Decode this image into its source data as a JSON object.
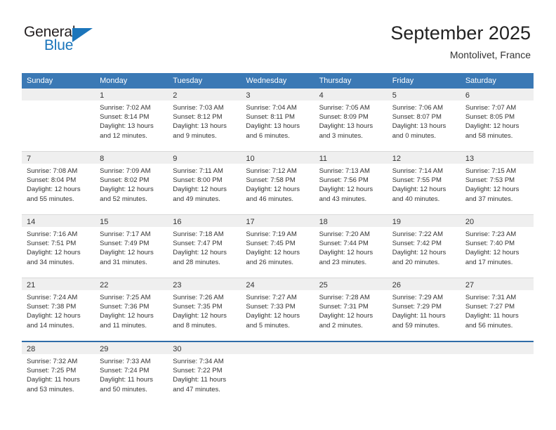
{
  "logo": {
    "text_primary": "General",
    "text_secondary": "Blue",
    "icon": "triangle-icon",
    "color_primary": "#231f20",
    "color_secondary": "#1b75bb"
  },
  "header": {
    "month_title": "September 2025",
    "location": "Montolivet, France"
  },
  "colors": {
    "header_blue": "#3b79b5",
    "day_band_gray": "#efefef",
    "separator_gray": "#d9d9d9",
    "last_row_border": "#2f6ca8",
    "text": "#333333"
  },
  "weekday_headers": [
    "Sunday",
    "Monday",
    "Tuesday",
    "Wednesday",
    "Thursday",
    "Friday",
    "Saturday"
  ],
  "weeks": [
    [
      {
        "day": "",
        "empty": true,
        "sunrise": "",
        "sunset": "",
        "daylight_1": "",
        "daylight_2": ""
      },
      {
        "day": "1",
        "sunrise": "Sunrise: 7:02 AM",
        "sunset": "Sunset: 8:14 PM",
        "daylight_1": "Daylight: 13 hours",
        "daylight_2": "and 12 minutes."
      },
      {
        "day": "2",
        "sunrise": "Sunrise: 7:03 AM",
        "sunset": "Sunset: 8:12 PM",
        "daylight_1": "Daylight: 13 hours",
        "daylight_2": "and 9 minutes."
      },
      {
        "day": "3",
        "sunrise": "Sunrise: 7:04 AM",
        "sunset": "Sunset: 8:11 PM",
        "daylight_1": "Daylight: 13 hours",
        "daylight_2": "and 6 minutes."
      },
      {
        "day": "4",
        "sunrise": "Sunrise: 7:05 AM",
        "sunset": "Sunset: 8:09 PM",
        "daylight_1": "Daylight: 13 hours",
        "daylight_2": "and 3 minutes."
      },
      {
        "day": "5",
        "sunrise": "Sunrise: 7:06 AM",
        "sunset": "Sunset: 8:07 PM",
        "daylight_1": "Daylight: 13 hours",
        "daylight_2": "and 0 minutes."
      },
      {
        "day": "6",
        "sunrise": "Sunrise: 7:07 AM",
        "sunset": "Sunset: 8:05 PM",
        "daylight_1": "Daylight: 12 hours",
        "daylight_2": "and 58 minutes."
      }
    ],
    [
      {
        "day": "7",
        "sunrise": "Sunrise: 7:08 AM",
        "sunset": "Sunset: 8:04 PM",
        "daylight_1": "Daylight: 12 hours",
        "daylight_2": "and 55 minutes."
      },
      {
        "day": "8",
        "sunrise": "Sunrise: 7:09 AM",
        "sunset": "Sunset: 8:02 PM",
        "daylight_1": "Daylight: 12 hours",
        "daylight_2": "and 52 minutes."
      },
      {
        "day": "9",
        "sunrise": "Sunrise: 7:11 AM",
        "sunset": "Sunset: 8:00 PM",
        "daylight_1": "Daylight: 12 hours",
        "daylight_2": "and 49 minutes."
      },
      {
        "day": "10",
        "sunrise": "Sunrise: 7:12 AM",
        "sunset": "Sunset: 7:58 PM",
        "daylight_1": "Daylight: 12 hours",
        "daylight_2": "and 46 minutes."
      },
      {
        "day": "11",
        "sunrise": "Sunrise: 7:13 AM",
        "sunset": "Sunset: 7:56 PM",
        "daylight_1": "Daylight: 12 hours",
        "daylight_2": "and 43 minutes."
      },
      {
        "day": "12",
        "sunrise": "Sunrise: 7:14 AM",
        "sunset": "Sunset: 7:55 PM",
        "daylight_1": "Daylight: 12 hours",
        "daylight_2": "and 40 minutes."
      },
      {
        "day": "13",
        "sunrise": "Sunrise: 7:15 AM",
        "sunset": "Sunset: 7:53 PM",
        "daylight_1": "Daylight: 12 hours",
        "daylight_2": "and 37 minutes."
      }
    ],
    [
      {
        "day": "14",
        "sunrise": "Sunrise: 7:16 AM",
        "sunset": "Sunset: 7:51 PM",
        "daylight_1": "Daylight: 12 hours",
        "daylight_2": "and 34 minutes."
      },
      {
        "day": "15",
        "sunrise": "Sunrise: 7:17 AM",
        "sunset": "Sunset: 7:49 PM",
        "daylight_1": "Daylight: 12 hours",
        "daylight_2": "and 31 minutes."
      },
      {
        "day": "16",
        "sunrise": "Sunrise: 7:18 AM",
        "sunset": "Sunset: 7:47 PM",
        "daylight_1": "Daylight: 12 hours",
        "daylight_2": "and 28 minutes."
      },
      {
        "day": "17",
        "sunrise": "Sunrise: 7:19 AM",
        "sunset": "Sunset: 7:45 PM",
        "daylight_1": "Daylight: 12 hours",
        "daylight_2": "and 26 minutes."
      },
      {
        "day": "18",
        "sunrise": "Sunrise: 7:20 AM",
        "sunset": "Sunset: 7:44 PM",
        "daylight_1": "Daylight: 12 hours",
        "daylight_2": "and 23 minutes."
      },
      {
        "day": "19",
        "sunrise": "Sunrise: 7:22 AM",
        "sunset": "Sunset: 7:42 PM",
        "daylight_1": "Daylight: 12 hours",
        "daylight_2": "and 20 minutes."
      },
      {
        "day": "20",
        "sunrise": "Sunrise: 7:23 AM",
        "sunset": "Sunset: 7:40 PM",
        "daylight_1": "Daylight: 12 hours",
        "daylight_2": "and 17 minutes."
      }
    ],
    [
      {
        "day": "21",
        "sunrise": "Sunrise: 7:24 AM",
        "sunset": "Sunset: 7:38 PM",
        "daylight_1": "Daylight: 12 hours",
        "daylight_2": "and 14 minutes."
      },
      {
        "day": "22",
        "sunrise": "Sunrise: 7:25 AM",
        "sunset": "Sunset: 7:36 PM",
        "daylight_1": "Daylight: 12 hours",
        "daylight_2": "and 11 minutes."
      },
      {
        "day": "23",
        "sunrise": "Sunrise: 7:26 AM",
        "sunset": "Sunset: 7:35 PM",
        "daylight_1": "Daylight: 12 hours",
        "daylight_2": "and 8 minutes."
      },
      {
        "day": "24",
        "sunrise": "Sunrise: 7:27 AM",
        "sunset": "Sunset: 7:33 PM",
        "daylight_1": "Daylight: 12 hours",
        "daylight_2": "and 5 minutes."
      },
      {
        "day": "25",
        "sunrise": "Sunrise: 7:28 AM",
        "sunset": "Sunset: 7:31 PM",
        "daylight_1": "Daylight: 12 hours",
        "daylight_2": "and 2 minutes."
      },
      {
        "day": "26",
        "sunrise": "Sunrise: 7:29 AM",
        "sunset": "Sunset: 7:29 PM",
        "daylight_1": "Daylight: 11 hours",
        "daylight_2": "and 59 minutes."
      },
      {
        "day": "27",
        "sunrise": "Sunrise: 7:31 AM",
        "sunset": "Sunset: 7:27 PM",
        "daylight_1": "Daylight: 11 hours",
        "daylight_2": "and 56 minutes."
      }
    ],
    [
      {
        "day": "28",
        "sunrise": "Sunrise: 7:32 AM",
        "sunset": "Sunset: 7:25 PM",
        "daylight_1": "Daylight: 11 hours",
        "daylight_2": "and 53 minutes."
      },
      {
        "day": "29",
        "sunrise": "Sunrise: 7:33 AM",
        "sunset": "Sunset: 7:24 PM",
        "daylight_1": "Daylight: 11 hours",
        "daylight_2": "and 50 minutes."
      },
      {
        "day": "30",
        "sunrise": "Sunrise: 7:34 AM",
        "sunset": "Sunset: 7:22 PM",
        "daylight_1": "Daylight: 11 hours",
        "daylight_2": "and 47 minutes."
      },
      {
        "day": "",
        "empty": true,
        "sunrise": "",
        "sunset": "",
        "daylight_1": "",
        "daylight_2": ""
      },
      {
        "day": "",
        "empty": true,
        "sunrise": "",
        "sunset": "",
        "daylight_1": "",
        "daylight_2": ""
      },
      {
        "day": "",
        "empty": true,
        "sunrise": "",
        "sunset": "",
        "daylight_1": "",
        "daylight_2": ""
      },
      {
        "day": "",
        "empty": true,
        "sunrise": "",
        "sunset": "",
        "daylight_1": "",
        "daylight_2": ""
      }
    ]
  ]
}
